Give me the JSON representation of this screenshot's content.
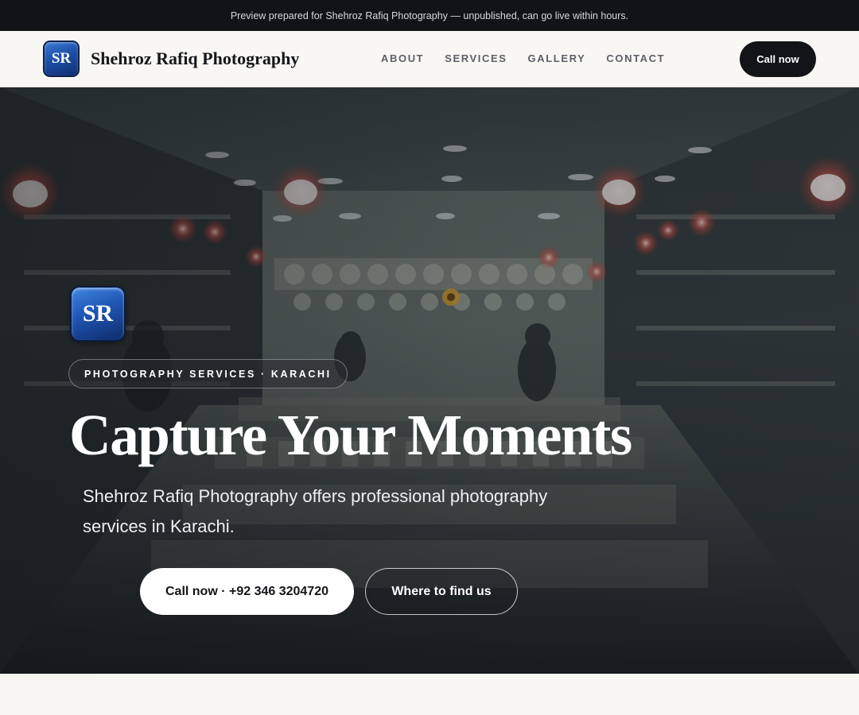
{
  "preview_banner": "Preview prepared for Shehroz Rafiq Photography — unpublished, can go live within hours.",
  "brand": {
    "logo_text": "SR",
    "name": "Shehroz Rafiq Photography"
  },
  "nav": {
    "links": [
      "ABOUT",
      "SERVICES",
      "GALLERY",
      "CONTACT"
    ],
    "cta_label": "Call now"
  },
  "hero": {
    "logo_text": "SR",
    "tag": "PHOTOGRAPHY SERVICES · KARACHI",
    "title": "Capture Your Moments",
    "description": "Shehroz Rafiq Photography offers professional photography services in Karachi.",
    "primary_button": "Call now · +92 346 3204720",
    "secondary_button": "Where to find us"
  },
  "colors": {
    "dark": "#121418",
    "page_bg": "#f8f7f3",
    "logo_blue": "#1f55b3"
  }
}
